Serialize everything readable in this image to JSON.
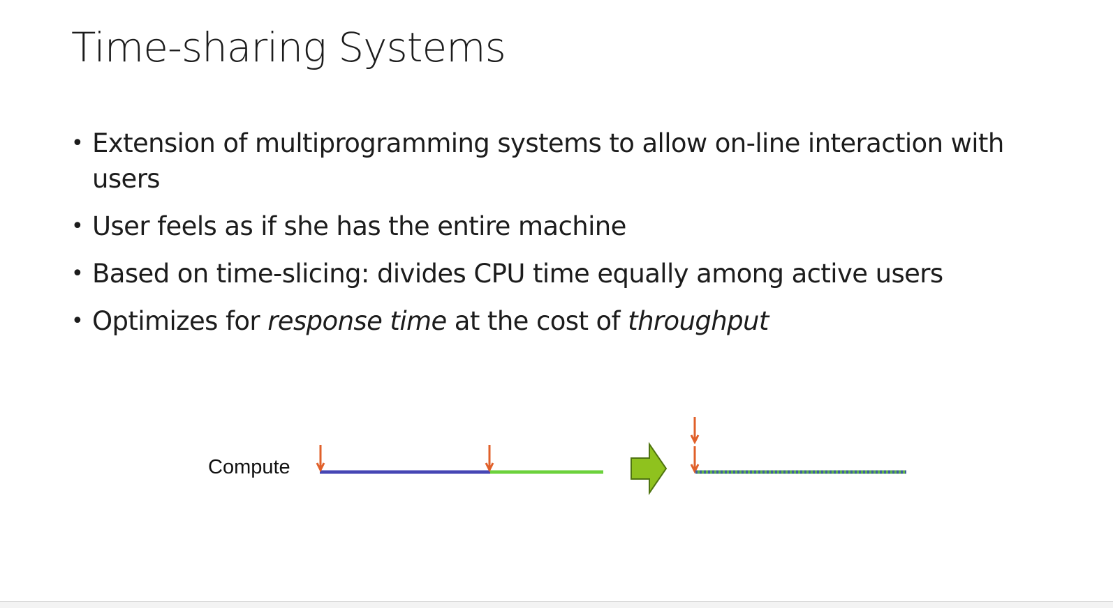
{
  "slide": {
    "title": "Time-sharing Systems",
    "bullets": [
      {
        "parts": [
          {
            "text": "Extension of multiprogramming systems to allow on-line interaction with users",
            "italic": false
          }
        ]
      },
      {
        "parts": [
          {
            "text": "User feels as if she has the entire machine",
            "italic": false
          }
        ]
      },
      {
        "parts": [
          {
            "text": "Based on time-slicing: divides CPU time equally among active users",
            "italic": false
          }
        ]
      },
      {
        "parts": [
          {
            "text": "Optimizes for ",
            "italic": false
          },
          {
            "text": "response time",
            "italic": true
          },
          {
            "text": " at the cost of ",
            "italic": false
          },
          {
            "text": "throughput",
            "italic": true
          }
        ]
      }
    ],
    "bullet_glyph": "•"
  },
  "diagram": {
    "label": "Compute",
    "colors": {
      "job_a": "#4646b4",
      "job_b": "#6cd23c",
      "arrival": "#e0602a",
      "transform_arrow": "#8fc21e",
      "transform_arrow_outline": "#4f7410",
      "interleaved_a": "#3d5f9e",
      "interleaved_b": "#5fb24a"
    },
    "icons": [
      "arrival-arrow-icon",
      "transform-arrow-icon"
    ]
  }
}
